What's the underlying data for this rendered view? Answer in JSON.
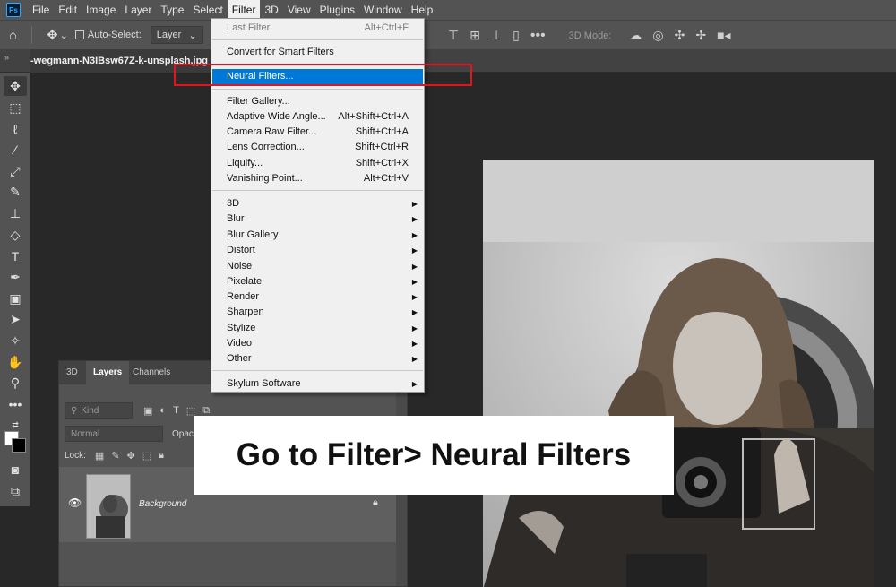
{
  "app": {
    "logo_text": "Ps"
  },
  "menubar": [
    "File",
    "Edit",
    "Image",
    "Layer",
    "Type",
    "Select",
    "Filter",
    "3D",
    "View",
    "Plugins",
    "Window",
    "Help"
  ],
  "options_bar": {
    "auto_select_label": "Auto-Select:",
    "auto_select_checked": false,
    "target_value": "Layer",
    "mode_3d_label": "3D Mode:"
  },
  "document_tab": {
    "title": "-wegmann-N3IBsw67Z-k-unsplash.jpg @"
  },
  "filter_menu": {
    "items": [
      {
        "label": "Last Filter",
        "shortcut": "Alt+Ctrl+F",
        "enabled": false
      },
      {
        "label": "Convert for Smart Filters",
        "shortcut": ""
      },
      {
        "label": "Neural Filters...",
        "shortcut": "",
        "highlighted": true
      },
      {
        "label": "Filter Gallery...",
        "shortcut": ""
      },
      {
        "label": "Adaptive Wide Angle...",
        "shortcut": "Alt+Shift+Ctrl+A"
      },
      {
        "label": "Camera Raw Filter...",
        "shortcut": "Shift+Ctrl+A"
      },
      {
        "label": "Lens Correction...",
        "shortcut": "Shift+Ctrl+R"
      },
      {
        "label": "Liquify...",
        "shortcut": "Shift+Ctrl+X"
      },
      {
        "label": "Vanishing Point...",
        "shortcut": "Alt+Ctrl+V"
      },
      {
        "label": "3D",
        "submenu": true
      },
      {
        "label": "Blur",
        "submenu": true
      },
      {
        "label": "Blur Gallery",
        "submenu": true
      },
      {
        "label": "Distort",
        "submenu": true
      },
      {
        "label": "Noise",
        "submenu": true
      },
      {
        "label": "Pixelate",
        "submenu": true
      },
      {
        "label": "Render",
        "submenu": true
      },
      {
        "label": "Sharpen",
        "submenu": true
      },
      {
        "label": "Stylize",
        "submenu": true
      },
      {
        "label": "Video",
        "submenu": true
      },
      {
        "label": "Other",
        "submenu": true
      },
      {
        "label": "Skylum Software",
        "submenu": true
      }
    ]
  },
  "layers_panel": {
    "tabs": [
      "3D",
      "Layers",
      "Channels"
    ],
    "active_tab": "Layers",
    "filter_kind_placeholder": "Kind",
    "blend_mode": "Normal",
    "opacity_label": "Opac",
    "lock_label": "Lock:",
    "layers": [
      {
        "name": "Background",
        "visible": true,
        "locked": true
      }
    ]
  },
  "caption": "Go to Filter> Neural Filters",
  "colors": {
    "menu_highlight": "#0078d7",
    "callout_box": "#e3141e",
    "ui_panel": "#535353"
  },
  "icons": {
    "tools": [
      "move-icon",
      "marquee-icon",
      "lasso-icon",
      "magic-wand-icon",
      "eyedropper-icon",
      "brush-icon",
      "stamp-icon",
      "eraser-icon",
      "type-icon",
      "pen-icon",
      "gradient-icon",
      "path-select-icon",
      "shape-icon",
      "hand-icon",
      "zoom-icon",
      "more-icon",
      "swap-colors-icon",
      "quick-mask-icon",
      "screen-mode-icon"
    ]
  }
}
